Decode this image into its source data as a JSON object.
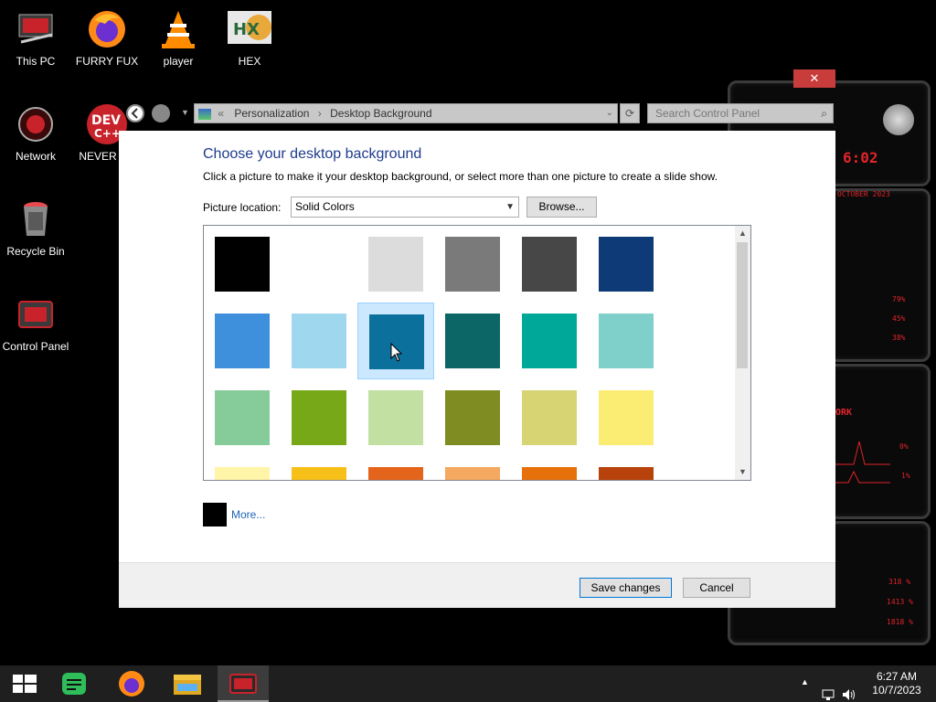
{
  "desktop": {
    "icons": [
      {
        "label": "This PC",
        "icon": "computer-icon"
      },
      {
        "label": "FURRY FUX",
        "icon": "firefox-icon"
      },
      {
        "label": "player",
        "icon": "vlc-icon"
      },
      {
        "label": "HEX",
        "icon": "hex-editor-icon"
      },
      {
        "label": "Network",
        "icon": "network-icon"
      },
      {
        "label": "NEVER US",
        "icon": "dev-cpp-icon"
      },
      {
        "label": "Recycle Bin",
        "icon": "recycle-bin-icon"
      },
      {
        "label": "Control Panel",
        "icon": "control-panel-icon"
      }
    ],
    "widget": {
      "time": "6:02",
      "date": "OCTOBER 2023",
      "stats": [
        "79%",
        "45%",
        "38%"
      ],
      "network_label": "ORK",
      "net_values": [
        "0%",
        "1%"
      ],
      "bottom_values": [
        "318 %",
        "1413 %",
        "1818 %"
      ],
      "accent": "#e0242a"
    }
  },
  "window": {
    "close_label": "✕",
    "breadcrumb": {
      "prefix": "«",
      "items": [
        "Personalization",
        "Desktop Background"
      ],
      "separator": "›"
    },
    "search_placeholder": "Search Control Panel",
    "title": "Choose your desktop background",
    "subtitle": "Click a picture to make it your desktop background, or select more than one picture to create a slide show.",
    "picture_location_label": "Picture location:",
    "picture_location_value": "Solid Colors",
    "browse_label": "Browse...",
    "swatches": [
      [
        "#000000",
        "#ffffff",
        "#dcdcdc",
        "#7a7a7a",
        "#474747",
        "#0e3a78"
      ],
      [
        "#3e8fdc",
        "#9fd8ee",
        "#0c709c",
        "#0b6665",
        "#00a89a",
        "#7fcfcb"
      ],
      [
        "#86cc9a",
        "#76a818",
        "#c1e0a1",
        "#7f8c22",
        "#d7d473",
        "#fbed73"
      ],
      [
        "#fff4a8",
        "#f7c018",
        "#e4641c",
        "#f4a860",
        "#e6700a",
        "#b8420c"
      ]
    ],
    "selected_swatch": {
      "row": 1,
      "col": 2
    },
    "more_label": "More...",
    "save_label": "Save changes",
    "cancel_label": "Cancel"
  },
  "taskbar": {
    "items": [
      "start-icon",
      "notes-icon",
      "firefox-icon",
      "file-explorer-icon",
      "control-panel-icon"
    ],
    "active_item": 4,
    "time": "6:27 AM",
    "date": "10/7/2023"
  }
}
